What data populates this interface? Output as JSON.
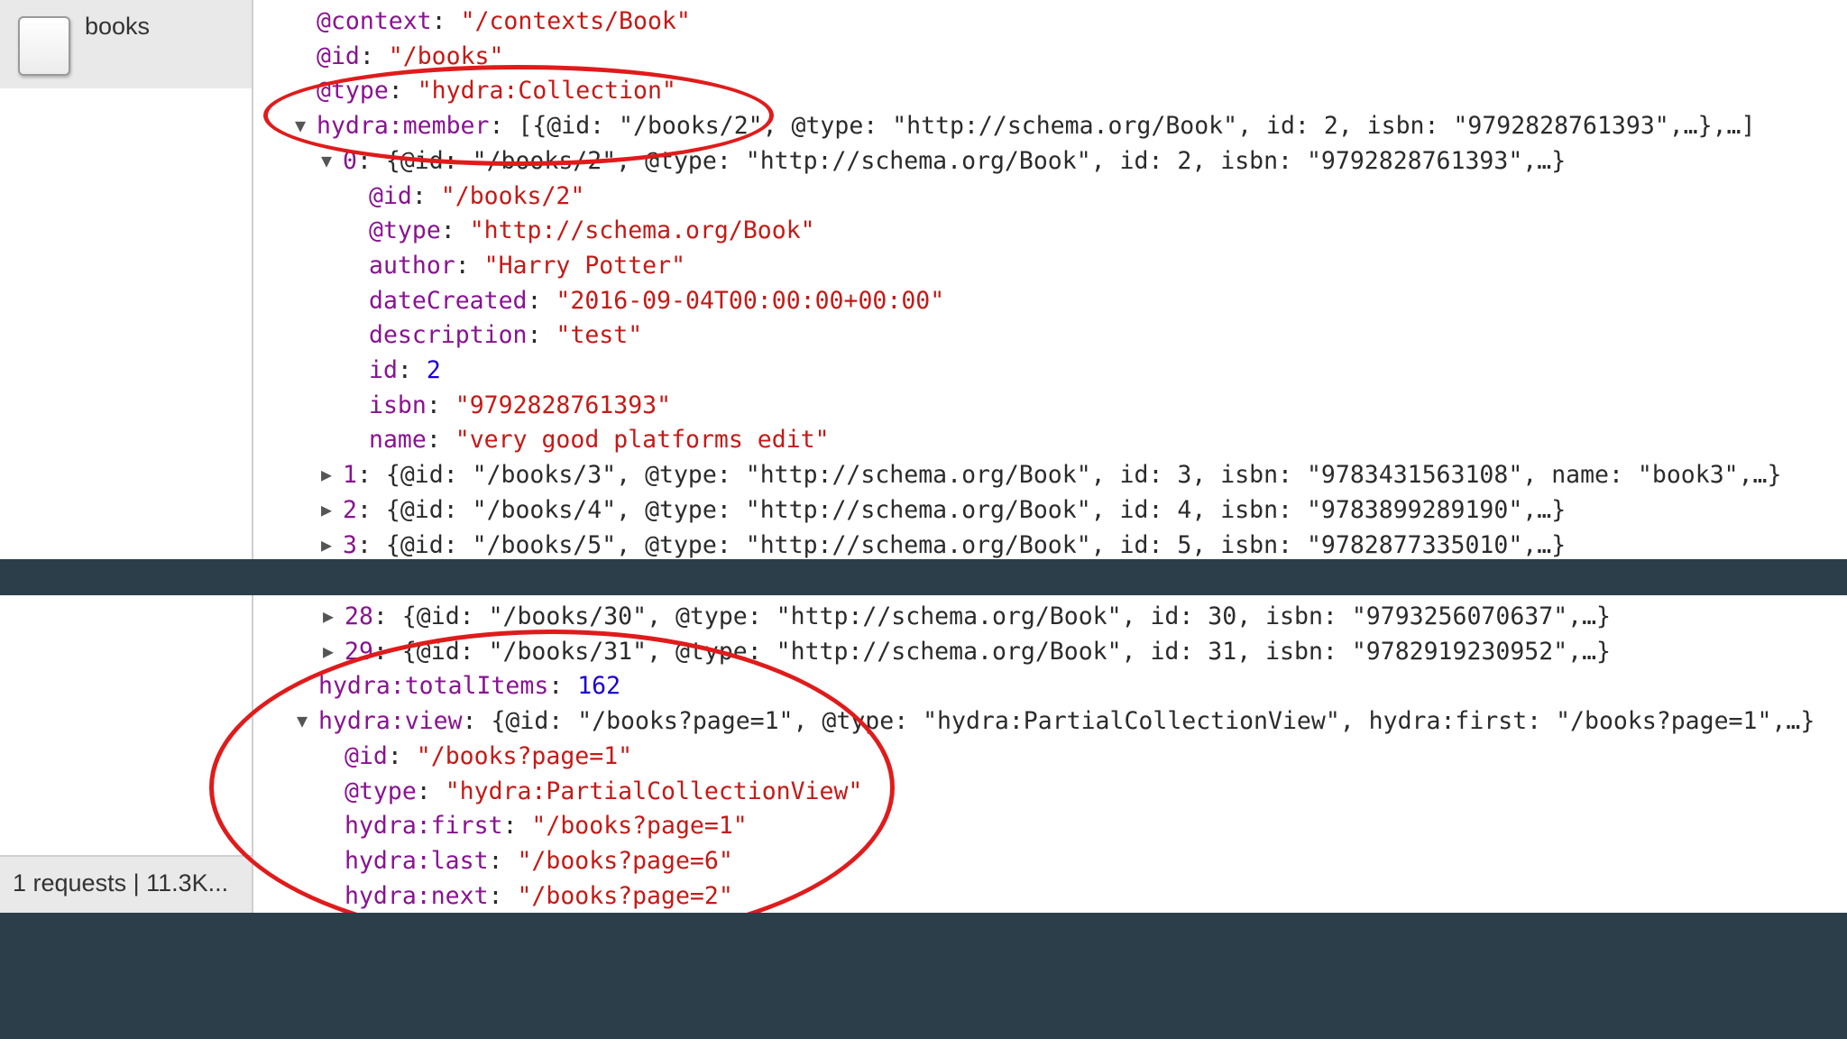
{
  "sidebar": {
    "request_name": "books",
    "status": "1 requests | 11.3K..."
  },
  "top_lines": [
    {
      "indent": 0,
      "arrow": "",
      "key": "@context",
      "rest": [
        {
          "t": "s",
          "v": "\"/contexts/Book\""
        }
      ]
    },
    {
      "indent": 0,
      "arrow": "",
      "key": "@id",
      "rest": [
        {
          "t": "s",
          "v": "\"/books\""
        }
      ]
    },
    {
      "indent": 0,
      "arrow": "",
      "key": "@type",
      "rest": [
        {
          "t": "s",
          "v": "\"hydra:Collection\""
        }
      ]
    },
    {
      "indent": 0,
      "arrow": "▼",
      "key": "hydra:member",
      "rest": [
        {
          "t": "p",
          "v": "[{@id: \"/books/2\", @type: \"http://schema.org/Book\", id: 2, isbn: \"9792828761393\",…},…]"
        }
      ]
    },
    {
      "indent": 1,
      "arrow": "▼",
      "key": "0",
      "rest": [
        {
          "t": "p",
          "v": "{@id: \"/books/2\", @type: \"http://schema.org/Book\", id: 2, isbn: \"9792828761393\",…}"
        }
      ]
    },
    {
      "indent": 2,
      "arrow": "",
      "key": "@id",
      "rest": [
        {
          "t": "s",
          "v": "\"/books/2\""
        }
      ]
    },
    {
      "indent": 2,
      "arrow": "",
      "key": "@type",
      "rest": [
        {
          "t": "s",
          "v": "\"http://schema.org/Book\""
        }
      ]
    },
    {
      "indent": 2,
      "arrow": "",
      "key": "author",
      "rest": [
        {
          "t": "s",
          "v": "\"Harry Potter\""
        }
      ]
    },
    {
      "indent": 2,
      "arrow": "",
      "key": "dateCreated",
      "rest": [
        {
          "t": "s",
          "v": "\"2016-09-04T00:00:00+00:00\""
        }
      ]
    },
    {
      "indent": 2,
      "arrow": "",
      "key": "description",
      "rest": [
        {
          "t": "s",
          "v": "\"test\""
        }
      ]
    },
    {
      "indent": 2,
      "arrow": "",
      "key": "id",
      "rest": [
        {
          "t": "n",
          "v": "2"
        }
      ]
    },
    {
      "indent": 2,
      "arrow": "",
      "key": "isbn",
      "rest": [
        {
          "t": "s",
          "v": "\"9792828761393\""
        }
      ]
    },
    {
      "indent": 2,
      "arrow": "",
      "key": "name",
      "rest": [
        {
          "t": "s",
          "v": "\"very good platforms edit\""
        }
      ]
    },
    {
      "indent": 1,
      "arrow": "▶",
      "key": "1",
      "rest": [
        {
          "t": "p",
          "v": "{@id: \"/books/3\", @type: \"http://schema.org/Book\", id: 3, isbn: \"9783431563108\", name: \"book3\",…}"
        }
      ]
    },
    {
      "indent": 1,
      "arrow": "▶",
      "key": "2",
      "rest": [
        {
          "t": "p",
          "v": "{@id: \"/books/4\", @type: \"http://schema.org/Book\", id: 4, isbn: \"9783899289190\",…}"
        }
      ]
    },
    {
      "indent": 1,
      "arrow": "▶",
      "key": "3",
      "rest": [
        {
          "t": "p",
          "v": "{@id: \"/books/5\", @type: \"http://schema.org/Book\", id: 5, isbn: \"9782877335010\",…}"
        }
      ]
    }
  ],
  "bottom_lines": [
    {
      "indent": 1,
      "arrow": "▶",
      "key": "28",
      "rest": [
        {
          "t": "p",
          "v": "{@id: \"/books/30\", @type: \"http://schema.org/Book\", id: 30, isbn: \"9793256070637\",…}"
        }
      ]
    },
    {
      "indent": 1,
      "arrow": "▶",
      "key": "29",
      "rest": [
        {
          "t": "p",
          "v": "{@id: \"/books/31\", @type: \"http://schema.org/Book\", id: 31, isbn: \"9782919230952\",…}"
        }
      ]
    },
    {
      "indent": 0,
      "arrow": "",
      "key": "hydra:totalItems",
      "rest": [
        {
          "t": "n",
          "v": "162"
        }
      ]
    },
    {
      "indent": 0,
      "arrow": "▼",
      "key": "hydra:view",
      "rest": [
        {
          "t": "p",
          "v": "{@id: \"/books?page=1\", @type: \"hydra:PartialCollectionView\", hydra:first: \"/books?page=1\",…}"
        }
      ]
    },
    {
      "indent": 1,
      "arrow": "",
      "key": "@id",
      "rest": [
        {
          "t": "s",
          "v": "\"/books?page=1\""
        }
      ]
    },
    {
      "indent": 1,
      "arrow": "",
      "key": "@type",
      "rest": [
        {
          "t": "s",
          "v": "\"hydra:PartialCollectionView\""
        }
      ]
    },
    {
      "indent": 1,
      "arrow": "",
      "key": "hydra:first",
      "rest": [
        {
          "t": "s",
          "v": "\"/books?page=1\""
        }
      ]
    },
    {
      "indent": 1,
      "arrow": "",
      "key": "hydra:last",
      "rest": [
        {
          "t": "s",
          "v": "\"/books?page=6\""
        }
      ]
    },
    {
      "indent": 1,
      "arrow": "",
      "key": "hydra:next",
      "rest": [
        {
          "t": "s",
          "v": "\"/books?page=2\""
        }
      ]
    }
  ],
  "colors": {
    "key": "#881391",
    "string": "#c41a16",
    "number": "#1c00cf",
    "highlight": "#e01b1b",
    "background": "#2c3e4a"
  }
}
